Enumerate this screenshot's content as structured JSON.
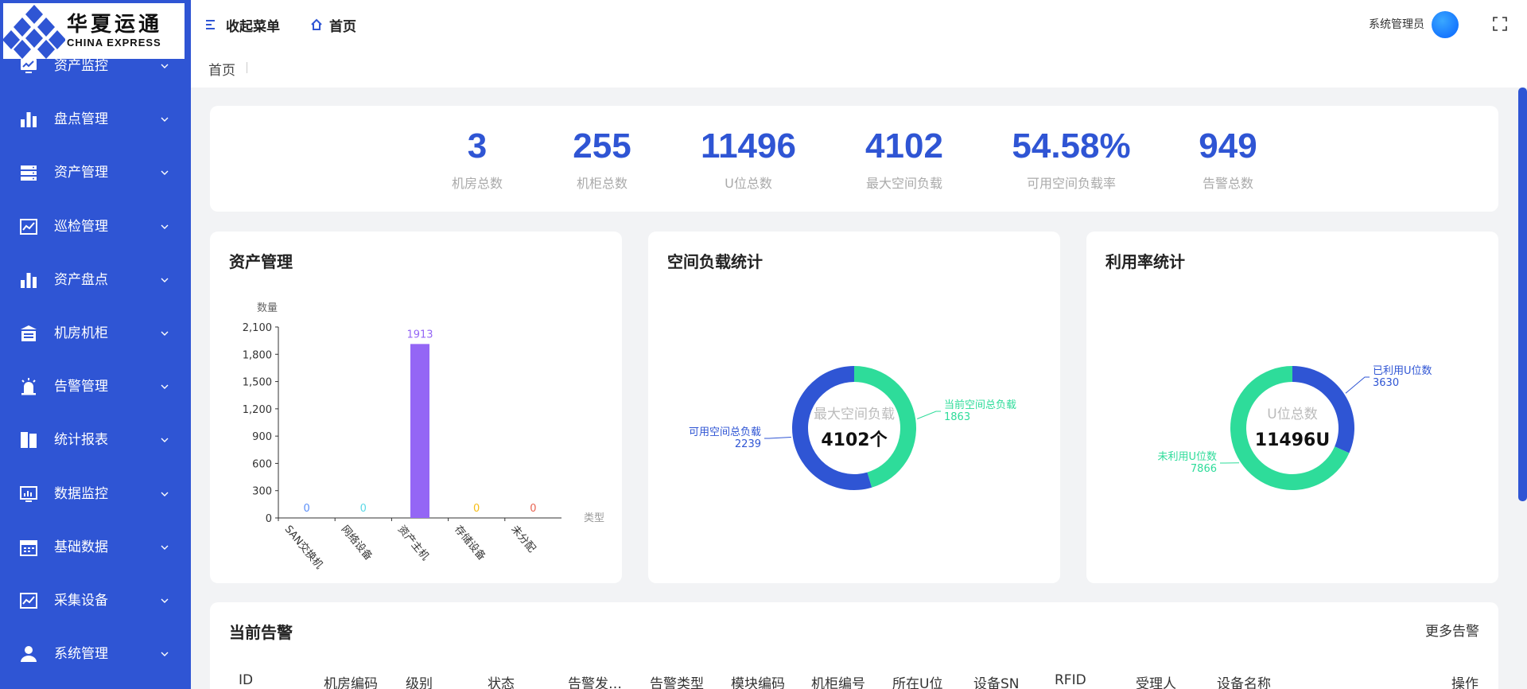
{
  "logo": {
    "cn": "华夏运通",
    "en": "CHINA EXPRESS"
  },
  "sidebar": {
    "items": [
      {
        "label": "资产监控",
        "icon": "monitor-chart-icon"
      },
      {
        "label": "盘点管理",
        "icon": "bar-chart-icon"
      },
      {
        "label": "资产管理",
        "icon": "server-icon"
      },
      {
        "label": "巡检管理",
        "icon": "line-chart-icon"
      },
      {
        "label": "资产盘点",
        "icon": "bar-chart-icon"
      },
      {
        "label": "机房机柜",
        "icon": "building-icon"
      },
      {
        "label": "告警管理",
        "icon": "alarm-icon"
      },
      {
        "label": "统计报表",
        "icon": "report-icon"
      },
      {
        "label": "数据监控",
        "icon": "monitor-icon"
      },
      {
        "label": "基础数据",
        "icon": "calendar-icon"
      },
      {
        "label": "采集设备",
        "icon": "line-chart-icon"
      },
      {
        "label": "系统管理",
        "icon": "user-icon"
      }
    ]
  },
  "header": {
    "collapse_label": "收起菜单",
    "home_label": "首页",
    "user_name": "系统管理员"
  },
  "breadcrumb": {
    "current": "首页"
  },
  "stats": [
    {
      "value": "3",
      "label": "机房总数"
    },
    {
      "value": "255",
      "label": "机柜总数"
    },
    {
      "value": "11496",
      "label": "U位总数"
    },
    {
      "value": "4102",
      "label": "最大空间负载"
    },
    {
      "value": "54.58%",
      "label": "可用空间负载率"
    },
    {
      "value": "949",
      "label": "告警总数"
    }
  ],
  "asset_card": {
    "title": "资产管理"
  },
  "space_card": {
    "title": "空间负载统计"
  },
  "util_card": {
    "title": "利用率统计"
  },
  "colors": {
    "accent": "#2f55d4",
    "green": "#2edc9a",
    "purple": "#9466f5"
  },
  "chart_data": [
    {
      "type": "bar",
      "ylabel": "数量",
      "xlabel": "类型",
      "categories": [
        "SAN交换机",
        "网络设备",
        "资产主机",
        "存储设备",
        "未分配"
      ],
      "values": [
        0,
        0,
        1913,
        0,
        0
      ],
      "value_label_colors": [
        "#5b8ff9",
        "#5ad8e6",
        "#9466f5",
        "#f6bd16",
        "#e86452"
      ],
      "yticks": [
        "0",
        "300",
        "600",
        "900",
        "1,200",
        "1,500",
        "1,800",
        "2,100"
      ],
      "ylim": [
        0,
        2100
      ],
      "grid": false
    },
    {
      "type": "pie",
      "center_title": "最大空间负载",
      "center_value": "4102个",
      "slices": [
        {
          "name": "当前空间总负载",
          "value": 1863,
          "color": "#2edc9a"
        },
        {
          "name": "可用空间总负载",
          "value": 2239,
          "color": "#2f55d4"
        }
      ]
    },
    {
      "type": "pie",
      "center_title": "U位总数",
      "center_value": "11496U",
      "slices": [
        {
          "name": "已利用U位数",
          "value": 3630,
          "color": "#2f55d4"
        },
        {
          "name": "未利用U位数",
          "value": 7866,
          "color": "#2edc9a"
        }
      ]
    }
  ],
  "alarm_card": {
    "title": "当前告警",
    "more_label": "更多告警",
    "columns": [
      "ID",
      "机房编码",
      "级别",
      "状态",
      "告警发…",
      "告警类型",
      "模块编码",
      "机柜编号",
      "所在U位",
      "设备SN",
      "RFID",
      "受理人",
      "设备名称",
      "操作"
    ]
  }
}
